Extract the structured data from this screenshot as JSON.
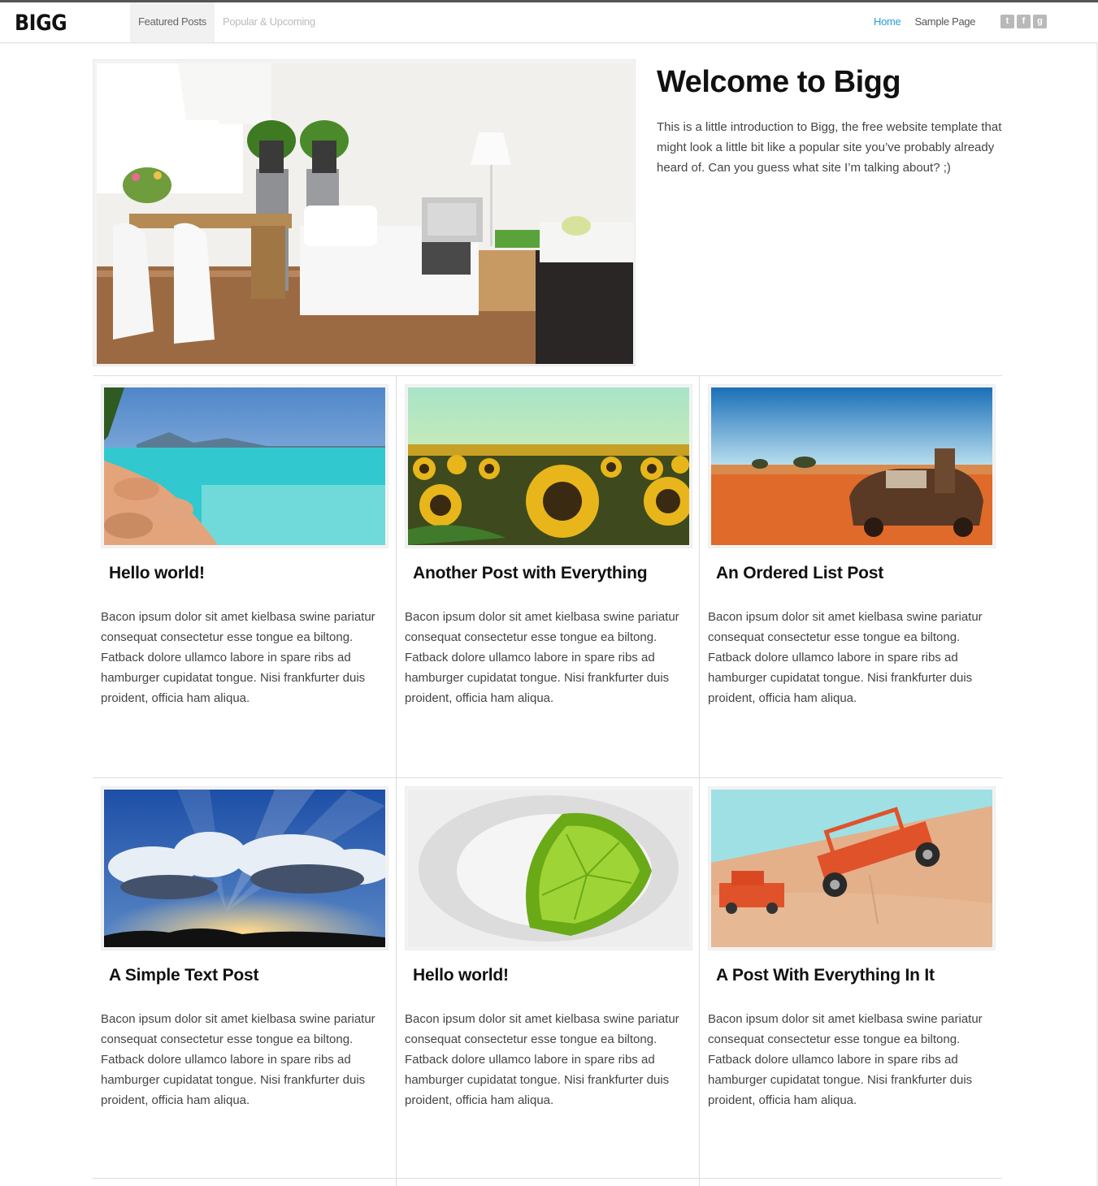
{
  "header": {
    "logo": "BIGG",
    "tabs": [
      {
        "label": "Featured Posts",
        "active": true
      },
      {
        "label": "Popular & Upcoming",
        "active": false
      }
    ],
    "nav": [
      {
        "label": "Home",
        "current": true
      },
      {
        "label": "Sample Page",
        "current": false
      }
    ],
    "social": [
      {
        "icon": "twitter-icon",
        "glyph": "t"
      },
      {
        "icon": "facebook-icon",
        "glyph": "f"
      },
      {
        "icon": "google-plus-icon",
        "glyph": "g"
      }
    ]
  },
  "hero": {
    "title": "Welcome to Bigg",
    "text": "This is a little introduction to Bigg, the free website template that might look a little bit like a popular site you’ve probably already heard of. Can you guess what site I’m talking about? ;)",
    "image": "living-room-photo"
  },
  "posts": [
    {
      "title": "Hello world!",
      "image": "beach-photo",
      "excerpt": "Bacon ipsum dolor sit amet kielbasa swine pariatur consequat consectetur esse tongue ea biltong. Fatback dolore ullamco labore in spare ribs ad hamburger cupidatat tongue. Nisi frankfurter duis proident, officia ham aliqua."
    },
    {
      "title": "Another Post with Everything",
      "image": "sunflowers-photo",
      "excerpt": "Bacon ipsum dolor sit amet kielbasa swine pariatur consequat consectetur esse tongue ea biltong. Fatback dolore ullamco labore in spare ribs ad hamburger cupidatat tongue. Nisi frankfurter duis proident, officia ham aliqua."
    },
    {
      "title": "An Ordered List Post",
      "image": "desert-car-photo",
      "excerpt": "Bacon ipsum dolor sit amet kielbasa swine pariatur consequat consectetur esse tongue ea biltong. Fatback dolore ullamco labore in spare ribs ad hamburger cupidatat tongue. Nisi frankfurter duis proident, officia ham aliqua."
    },
    {
      "title": "A Simple Text Post",
      "image": "sky-clouds-photo",
      "excerpt": "Bacon ipsum dolor sit amet kielbasa swine pariatur consequat consectetur esse tongue ea biltong. Fatback dolore ullamco labore in spare ribs ad hamburger cupidatat tongue. Nisi frankfurter duis proident, officia ham aliqua."
    },
    {
      "title": "Hello world!",
      "image": "lime-splash-photo",
      "excerpt": "Bacon ipsum dolor sit amet kielbasa swine pariatur consequat consectetur esse tongue ea biltong. Fatback dolore ullamco labore in spare ribs ad hamburger cupidatat tongue. Nisi frankfurter duis proident, officia ham aliqua."
    },
    {
      "title": "A Post With Everything In It",
      "image": "toy-jeep-photo",
      "excerpt": "Bacon ipsum dolor sit amet kielbasa swine pariatur consequat consectetur esse tongue ea biltong. Fatback dolore ullamco labore in spare ribs ad hamburger cupidatat tongue. Nisi frankfurter duis proident, officia ham aliqua."
    }
  ],
  "colors": {
    "link_active": "#2a9fd6",
    "text": "#444444",
    "heading": "#111111",
    "divider": "#dddddd"
  }
}
